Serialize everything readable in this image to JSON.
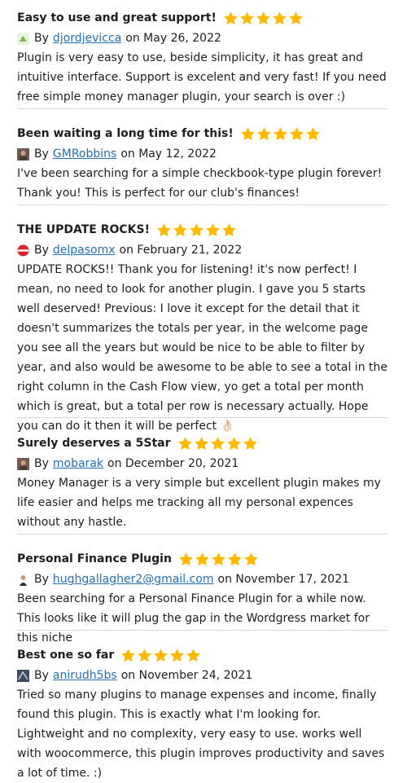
{
  "reviews": [
    {
      "title": "Easy to use and great support!",
      "rating": 5,
      "by": "By",
      "author": "djordjevicca",
      "on_date": "on May 26, 2022",
      "content": "Plugin is very easy to use, beside simplicity, it has great and intuitive interface. Support is excelent and very fast! If you need free simple money manager plugin, your search is over :)",
      "avatar_color": "#7fb24a"
    },
    {
      "title": "Been waiting a long time for this!",
      "rating": 5,
      "by": "By",
      "author": "GMRobbins",
      "on_date": "on May 12, 2022",
      "content": "I've been searching for a simple checkbook-type plugin forever! Thank you! This is perfect for our club's finances!",
      "avatar_color": "#6b5a4a"
    },
    {
      "title": "THE UPDATE ROCKS!",
      "rating": 5,
      "by": "By",
      "author": "delpasomx",
      "on_date": "on February 21, 2022",
      "content": "UPDATE ROCKS!! Thank you for listening! it's now perfect! I mean, no need to look for another plugin. I gave you 5 starts well deserved! Previous: I love it except for the detail that it doesn't summarizes the totals per year, in the welcome page you see all the years but would be nice to be able to filter by year, and also would be awesome to be able to see a total in the right column in the Cash Flow view, yo get a total per month which is great, but a total per row is necessary actually. Hope you can do it then it will be perfect 👌🏻",
      "avatar_color": "#d9262b"
    },
    {
      "title": "Surely deserves a 5Star",
      "rating": 5,
      "by": "By",
      "author": "mobarak",
      "on_date": "on December 20, 2021",
      "content": "Money Manager is a very simple but excellent plugin makes my life easier and helps me tracking all my personal expences without any hastle.",
      "avatar_color": "#7a5a50"
    },
    {
      "title": "Personal Finance Plugin",
      "rating": 5,
      "by": "By",
      "author": "hughgallagher2@gmail.com",
      "on_date": "on November 17, 2021",
      "content": "Been searching for a Personal Finance Plugin for a while now. This looks like it will plug the gap in the Wordgress market for this niche",
      "avatar_color": "#c8a27a"
    },
    {
      "title": "Best one so far",
      "rating": 5,
      "by": "By",
      "author": "anirudh5bs",
      "on_date": "on November 24, 2021",
      "content": "Tried so many plugins to manage expenses and income, finally found this plugin. This is exactly what I'm looking for. Lightweight and no complexity, very easy to use. works well with woocommerce, this plugin improves productivity and saves a lot of time. :)",
      "avatar_color": "#3d4b63"
    }
  ],
  "colors": {
    "star": "#ffb900",
    "link": "#2271b1",
    "text": "#1e1e1e",
    "separator": "#d6d6d6"
  }
}
